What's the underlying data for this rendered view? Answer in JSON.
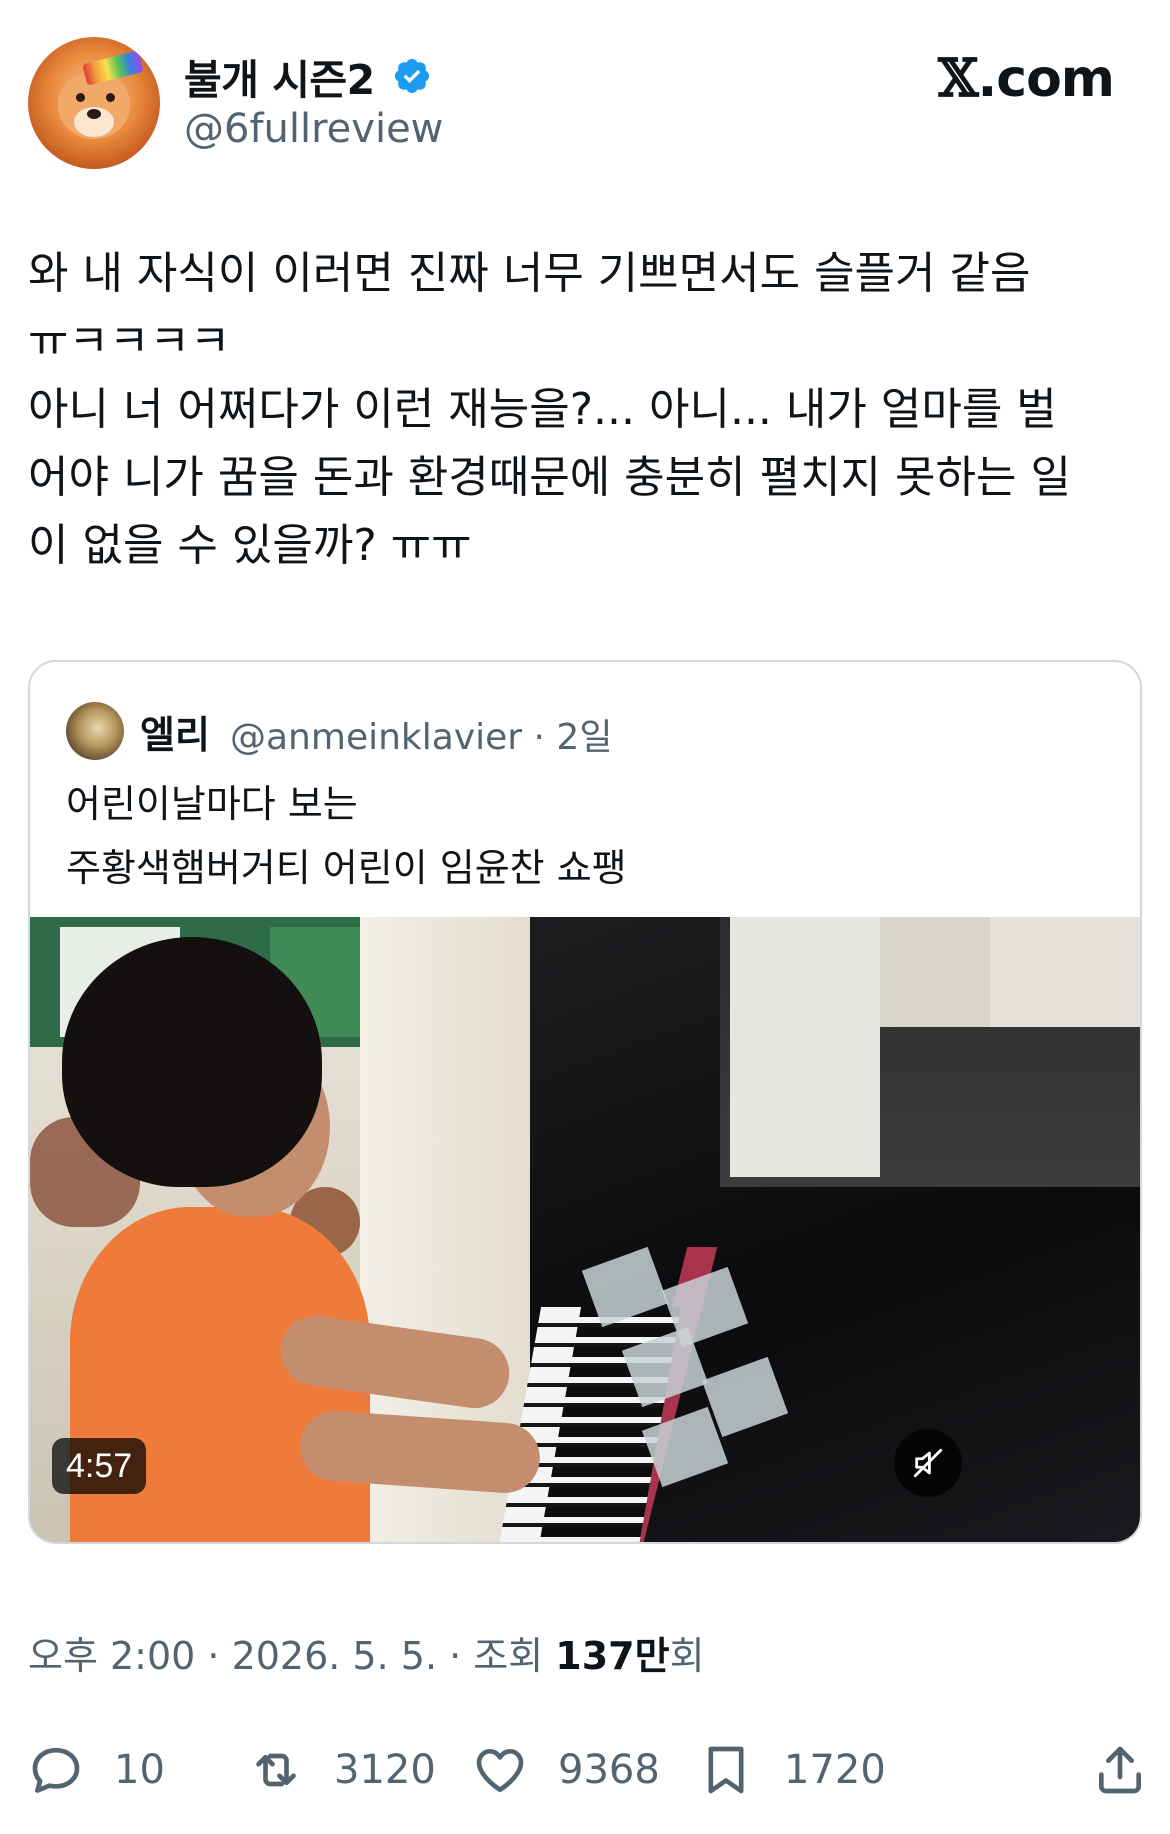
{
  "author": {
    "name": "불개 시즌2",
    "handle": "@6fullreview",
    "verified": true
  },
  "brand": {
    "x_mark": "𝕏",
    "domain": ".com"
  },
  "tweet": {
    "text": "와 내 자식이 이러면 진짜 너무 기쁘면서도 슬플거 같음\nㅠㅋㅋㅋㅋ\n아니 너 어쩌다가 이런 재능을?... 아니... 내가 얼마를 벌\n어야 니가 꿈을 돈과 환경때문에 충분히 펼치지 못하는 일\n이 없을 수 있을까? ㅠㅠ"
  },
  "quote": {
    "name": "엘리",
    "handle_time": "@anmeinklavier · 2일",
    "text": "어린이날마다 보는\n주황색햄버거티 어린이 임윤찬 쇼팽",
    "video": {
      "duration": "4:57",
      "muted_icon": "speaker-muted-icon"
    }
  },
  "meta": {
    "time_date": "오후 2:00 · 2026. 5. 5. · 조회 ",
    "views": "137만",
    "views_suffix": "회"
  },
  "actions": {
    "replies": "10",
    "reposts": "3120",
    "likes": "9368",
    "bookmarks": "1720"
  },
  "colors": {
    "text_primary": "#0f1419",
    "text_secondary": "#536471",
    "verified_blue": "#1d9bf0",
    "border": "#cfd9de"
  }
}
